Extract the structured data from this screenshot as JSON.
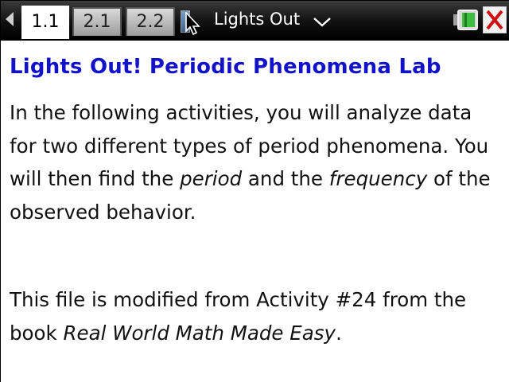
{
  "toolbar": {
    "tabs": [
      {
        "label": "1.1",
        "active": true
      },
      {
        "label": "2.1",
        "active": false
      },
      {
        "label": "2.2",
        "active": false
      }
    ],
    "document_title": "Lights Out",
    "icons": [
      "left-arrow-icon",
      "cursor-icon",
      "chevron-down-icon",
      "battery-icon",
      "close-icon"
    ]
  },
  "content": {
    "title": "Lights Out! Periodic Phenomena Lab",
    "paragraph1": {
      "part1": "In the following activities, you will analyze data for two different types of period phenomena. You will then find the ",
      "em1": "period",
      "part2": " and the ",
      "em2": "frequency",
      "part3": " of the observed behavior."
    },
    "paragraph2": {
      "part1": "This file is modified from Activity #24 from the book ",
      "em1": "Real World Math Made Easy",
      "part2": "."
    }
  },
  "colors": {
    "title_blue": "#1212c8",
    "toolbar_black": "#000000",
    "close_red": "#d01010",
    "battery_green": "#3fbf3f"
  }
}
